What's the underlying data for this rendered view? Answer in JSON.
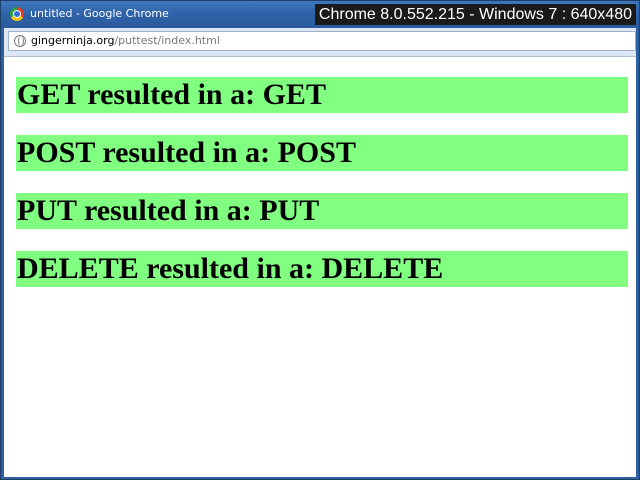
{
  "window": {
    "title": "untitled - Google Chrome",
    "overlay_label": "Chrome 8.0.552.215 - Windows 7 : 640x480",
    "icon": "chrome-icon"
  },
  "omnibox": {
    "icon": "globe-icon",
    "url_host": "gingerninja.org",
    "url_path": "/puttest/index.html"
  },
  "results": [
    "GET resulted in a: GET",
    "POST resulted in a: POST",
    "PUT resulted in a: PUT",
    "DELETE resulted in a: DELETE"
  ],
  "colors": {
    "result_background": "#80ff80",
    "titlebar": "#2f5f9e"
  }
}
